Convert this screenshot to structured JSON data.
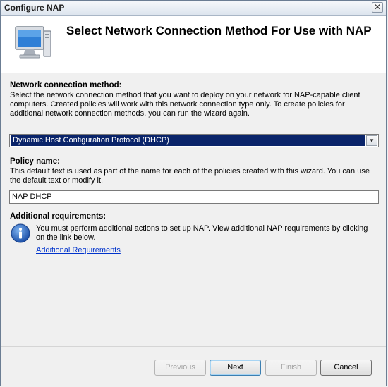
{
  "window": {
    "title": "Configure NAP",
    "close_label": "✕"
  },
  "header": {
    "title": "Select Network Connection Method For Use with NAP"
  },
  "method": {
    "label": "Network connection method:",
    "description": "Select the network connection method that you want to deploy on your network for NAP-capable client computers. Created policies will work with this network connection type only. To create policies for additional network connection methods, you can run the wizard again.",
    "selected": "Dynamic Host Configuration Protocol (DHCP)"
  },
  "policy": {
    "label": "Policy name:",
    "description": "This default text is used as part of the name for each of the policies created with this wizard. You can use the default text or modify it.",
    "value": "NAP DHCP"
  },
  "requirements": {
    "label": "Additional requirements:",
    "text": "You must perform additional actions to set up NAP. View additional NAP requirements by clicking on the link below.",
    "link": "Additional Requirements"
  },
  "buttons": {
    "previous": "Previous",
    "next": "Next",
    "finish": "Finish",
    "cancel": "Cancel"
  },
  "icons": {
    "header": "computer-monitor-icon",
    "info": "info-icon",
    "dropdown": "chevron-down-icon"
  },
  "colors": {
    "selection": "#0a246a",
    "link": "#0033cc"
  }
}
